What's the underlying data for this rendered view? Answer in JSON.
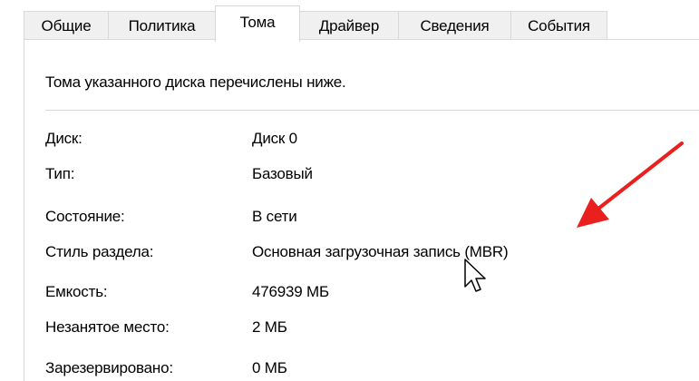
{
  "tabs": [
    {
      "label": "Общие",
      "selected": false
    },
    {
      "label": "Политика",
      "selected": false
    },
    {
      "label": "Тома",
      "selected": true
    },
    {
      "label": "Драйвер",
      "selected": false
    },
    {
      "label": "Сведения",
      "selected": false
    },
    {
      "label": "События",
      "selected": false
    }
  ],
  "description": "Тома указанного диска перечислены ниже.",
  "properties": [
    {
      "label": "Диск:",
      "value": "Диск 0"
    },
    {
      "label": "Тип:",
      "value": "Базовый"
    },
    {
      "label": "Состояние:",
      "value": "В сети"
    },
    {
      "label": "Стиль раздела:",
      "value": "Основная загрузочная запись (MBR)"
    },
    {
      "label": "Емкость:",
      "value": "476939 МБ"
    },
    {
      "label": "Незанятое место:",
      "value": "2 МБ"
    },
    {
      "label": "Зарезервировано:",
      "value": "0 МБ"
    }
  ],
  "annotation": {
    "arrow_color": "#e8201e",
    "arrow_icon": "red-arrow-icon",
    "cursor_icon": "mouse-pointer-icon"
  }
}
